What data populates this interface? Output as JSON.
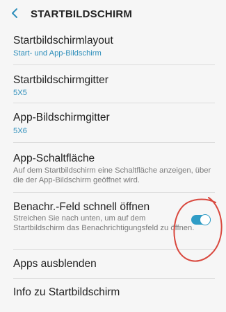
{
  "header": {
    "title": "STARTBILDSCHIRM",
    "back_icon": "chevron-left-icon"
  },
  "settings": [
    {
      "title": "Startbildschirmlayout",
      "value": "Start- und App-Bildschirm"
    },
    {
      "title": "Startbildschirmgitter",
      "value": "5X5"
    },
    {
      "title": "App-Bildschirmgitter",
      "value": "5X6"
    },
    {
      "title": "App-Schaltfläche",
      "description": "Auf dem Startbildschirm eine Schaltfläche anzeigen, über die der App-Bildschirm geöffnet wird."
    },
    {
      "title": "Benachr.-Feld schnell öffnen",
      "description": "Streichen Sie nach unten, um auf dem Startbildschirm das Benachrichtigungsfeld zu öffnen.",
      "toggle_on": true
    },
    {
      "title": "Apps ausblenden"
    },
    {
      "title": "Info zu Startbildschirm"
    }
  ],
  "colors": {
    "accent": "#2f9cc6",
    "annotation": "#d9483e"
  }
}
